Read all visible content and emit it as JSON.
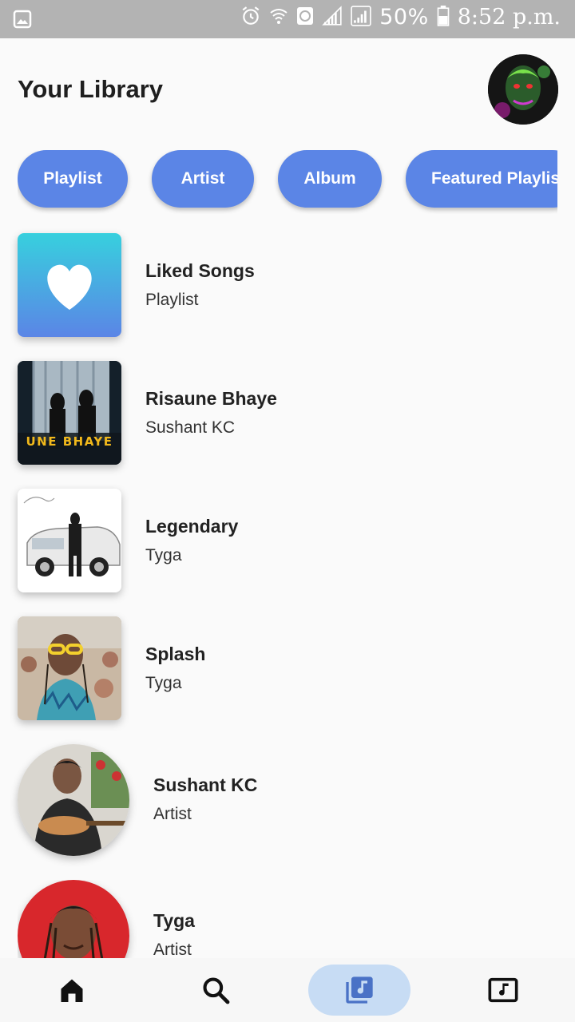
{
  "status_bar": {
    "battery": "50%",
    "time": "8:52 p.m.",
    "icons": [
      "image-icon",
      "alarm-icon",
      "wifi-icon",
      "data-saver-icon",
      "signal-icon",
      "signal-icon",
      "battery-icon"
    ]
  },
  "header": {
    "title": "Your Library"
  },
  "filters": [
    {
      "label": "Playlist"
    },
    {
      "label": "Artist"
    },
    {
      "label": "Album"
    },
    {
      "label": "Featured Playlist"
    }
  ],
  "library": [
    {
      "title": "Liked Songs",
      "subtitle": "Playlist"
    },
    {
      "title": "Risaune Bhaye",
      "subtitle": "Sushant KC",
      "cover_text": "UNE BHAYE"
    },
    {
      "title": "Legendary",
      "subtitle": "Tyga"
    },
    {
      "title": "Splash",
      "subtitle": "Tyga"
    },
    {
      "title": "Sushant KC",
      "subtitle": "Artist"
    },
    {
      "title": "Tyga",
      "subtitle": "Artist"
    }
  ],
  "bottom_nav": {
    "items": [
      "home-icon",
      "search-icon",
      "library-icon",
      "music-video-icon"
    ],
    "active_index": 2
  },
  "colors": {
    "accent": "#5b85e6",
    "active_nav_bg": "#c7dcf4",
    "status_bar": "#b3b3b3"
  }
}
